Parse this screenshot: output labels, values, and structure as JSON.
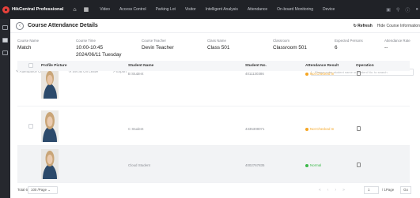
{
  "app": {
    "title": "HikCentral Professional"
  },
  "nav": {
    "items": [
      "Video",
      "Access Control",
      "Parking Lot",
      "Visitor",
      "Intelligent Analysis",
      "Attendance",
      "On-board Monitoring",
      "Device"
    ]
  },
  "page": {
    "title": "Course Attendance Details",
    "refresh": "Refresh",
    "hide_info": "Hide Course Information"
  },
  "course": {
    "name_label": "Course Name",
    "name": "Match",
    "time_label": "Course Time",
    "time": "10:00-10:45",
    "date": "2024/06/11 Tuesday",
    "teacher_label": "Course Teacher",
    "teacher": "Devin Teacher",
    "class_label": "Class Name",
    "class": "Class 501",
    "classroom_label": "Classroom",
    "classroom": "Classroom 501",
    "expected_label": "Expected Persons",
    "expected": "6",
    "rate_label": "Attendance Rate",
    "rate": "--"
  },
  "toolbar": {
    "correction": "Attendance Correction",
    "leave": "Set as On Leave",
    "export": "Export"
  },
  "search": {
    "placeholder": "Please enter student name or student No. to search"
  },
  "table": {
    "headers": {
      "photo": "Profile Picture",
      "name": "Student Name",
      "no": "Student No.",
      "result": "Attendance Result",
      "op": "Operation"
    },
    "rows": [
      {
        "name": "B Student",
        "no": "4011130386",
        "result": "Not Checked In",
        "status_color": "#f5a623"
      },
      {
        "name": "C Student",
        "no": "4335308071",
        "result": "Not Checked In",
        "status_color": "#f5a623"
      },
      {
        "name": "Cloud Student",
        "no": "4002767835",
        "result": "Normal",
        "status_color": "#3db84a"
      }
    ]
  },
  "pager": {
    "total": "Total 6",
    "page_size": "100 /Page",
    "page": "1",
    "of_pages": "/ 1Page",
    "go": "Go"
  }
}
